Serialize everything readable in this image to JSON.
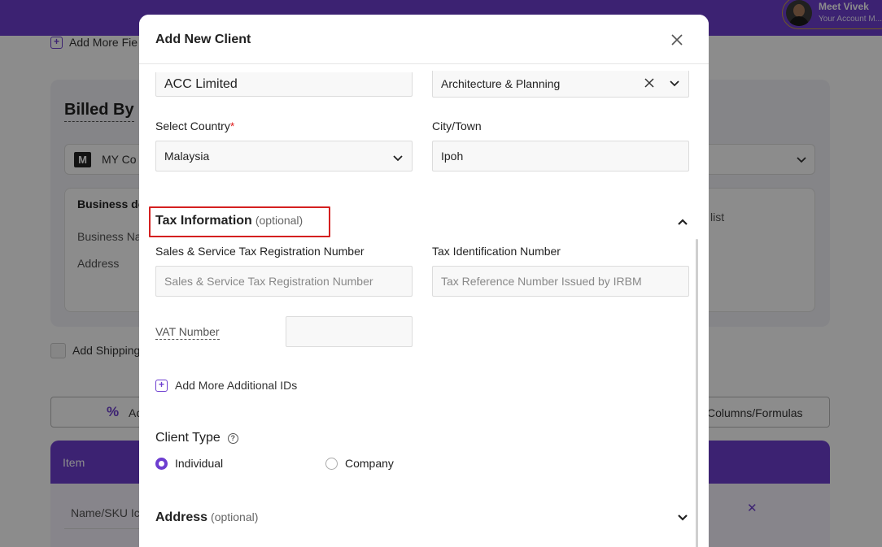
{
  "header": {
    "user_name": "Meet Vivek",
    "user_sub": "Your Account M..."
  },
  "background": {
    "add_more_fields": "Add More Fie",
    "billed_by": "Billed By",
    "company_badge": "M",
    "company_name": "MY Co",
    "business_details": "Business de",
    "business_name": "Business Na",
    "address": "Address",
    "list_text": "list",
    "add_shipping": "Add Shipping",
    "add_discount": "Ac",
    "columns_formulas": "Columns/Formulas",
    "item_header": "Item",
    "name_sku": "Name/SKU Ic"
  },
  "modal": {
    "title": "Add New Client",
    "company_name_value": "ACC Limited",
    "industry_value": "Architecture & Planning",
    "country_label": "Select Country",
    "country_required": "*",
    "country_value": "Malaysia",
    "city_label": "City/Town",
    "city_value": "Ipoh",
    "tax_section": {
      "title": "Tax Information",
      "optional": "(optional)",
      "expanded": true
    },
    "sst_label": "Sales & Service Tax Registration Number",
    "sst_placeholder": "Sales & Service Tax Registration Number",
    "tin_label": "Tax Identification Number",
    "tin_placeholder": "Tax Reference Number Issued by IRBM",
    "vat_label": "VAT Number",
    "vat_value": "",
    "add_ids": "Add More Additional IDs",
    "client_type_label": "Client Type",
    "client_types": [
      {
        "label": "Individual",
        "selected": true
      },
      {
        "label": "Company",
        "selected": false
      }
    ],
    "address_section": {
      "title": "Address",
      "optional": "(optional)",
      "expanded": false
    }
  },
  "colors": {
    "brand": "#6d3ed0",
    "highlight": "#d42020"
  }
}
